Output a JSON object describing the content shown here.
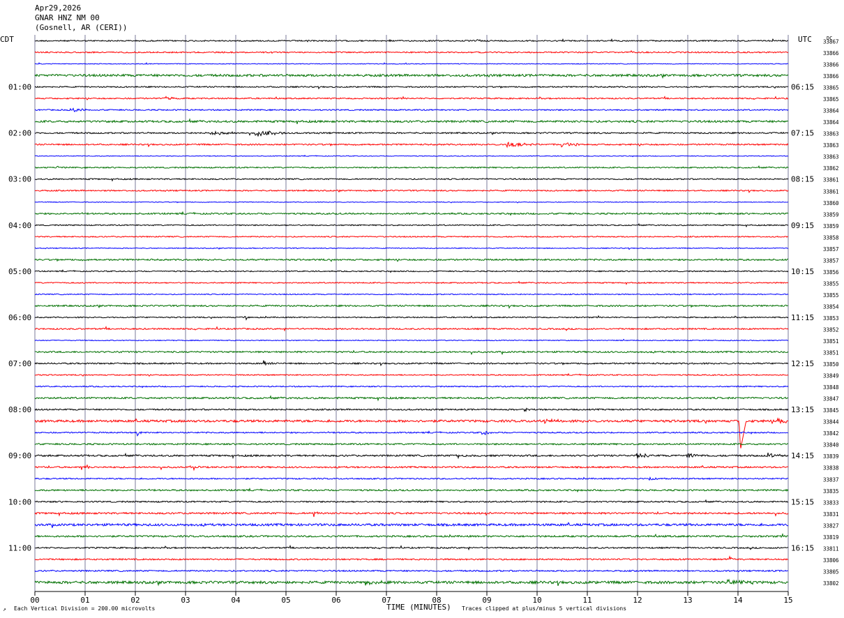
{
  "header": {
    "date": "Apr29,2026",
    "station": "GNAR HNZ NM 00",
    "location": "(Gosnell, AR (CERI))"
  },
  "labels": {
    "left_tz": "CDT",
    "right_tz": "UTC",
    "dc": "DC",
    "xlabel": "TIME (MINUTES)",
    "scale_note": "Each Vertical Division =  200.00 microvolts",
    "clip_note": "Traces clipped at plus/minus 5 vertical divisions"
  },
  "colors": {
    "cycle": [
      "#000000",
      "#ff0000",
      "#0000ff",
      "#007000"
    ],
    "grid_vertical": "#7a7a9a"
  },
  "chart_data": {
    "type": "line",
    "title": "",
    "xlabel": "TIME (MINUTES)",
    "ylabel": "",
    "xlim": [
      0,
      15
    ],
    "x_ticks": [
      "00",
      "01",
      "02",
      "03",
      "04",
      "05",
      "06",
      "07",
      "08",
      "09",
      "10",
      "11",
      "12",
      "13",
      "14",
      "15"
    ],
    "grid": true,
    "rows_count": 48,
    "left_hour_labels": [
      "01:00",
      "02:00",
      "03:00",
      "04:00",
      "05:00",
      "06:00",
      "07:00",
      "08:00",
      "09:00",
      "10:00",
      "11:00"
    ],
    "right_hour_labels": [
      "06:15",
      "07:15",
      "08:15",
      "09:15",
      "10:15",
      "11:15",
      "12:15",
      "13:15",
      "14:15",
      "15:15",
      "16:15"
    ],
    "dc_offsets": [
      33867,
      33866,
      33866,
      33866,
      33865,
      33865,
      33864,
      33864,
      33863,
      33863,
      33863,
      33862,
      33861,
      33861,
      33860,
      33859,
      33859,
      33858,
      33857,
      33857,
      33856,
      33855,
      33855,
      33854,
      33853,
      33852,
      33851,
      33851,
      33850,
      33849,
      33848,
      33847,
      33845,
      33844,
      33842,
      33840,
      33839,
      33838,
      33837,
      33835,
      33833,
      33831,
      33827,
      33819,
      33811,
      33806,
      33805,
      33802
    ],
    "noise": [
      0.9,
      0.9,
      0.5,
      1.6,
      0.9,
      0.9,
      0.9,
      1.4,
      1.0,
      1.0,
      0.5,
      0.9,
      0.9,
      0.9,
      0.5,
      1.1,
      0.8,
      0.8,
      0.6,
      1.1,
      0.8,
      0.8,
      0.7,
      1.1,
      0.8,
      1.0,
      0.6,
      1.1,
      1.0,
      0.8,
      0.8,
      1.2,
      1.0,
      1.6,
      0.9,
      1.1,
      1.2,
      1.1,
      0.9,
      1.1,
      1.0,
      1.2,
      1.6,
      1.2,
      1.0,
      1.0,
      1.0,
      1.8
    ],
    "events": [
      {
        "row": 0,
        "minute": 8.8,
        "amp": 3,
        "dur": 0.1
      },
      {
        "row": 5,
        "minute": 2.6,
        "amp": 3,
        "dur": 0.3
      },
      {
        "row": 6,
        "minute": 0.7,
        "amp": 3,
        "dur": 0.4
      },
      {
        "row": 8,
        "minute": 4.4,
        "amp": 6,
        "dur": 0.6
      },
      {
        "row": 8,
        "minute": 3.5,
        "amp": 3,
        "dur": 0.6
      },
      {
        "row": 9,
        "minute": 9.4,
        "amp": 4,
        "dur": 0.6
      },
      {
        "row": 9,
        "minute": 10.5,
        "amp": 4,
        "dur": 0.6
      },
      {
        "row": 11,
        "minute": 0.45,
        "amp": 4,
        "dur": 0.05
      },
      {
        "row": 24,
        "minute": 4.2,
        "amp": 4,
        "dur": 0.1
      },
      {
        "row": 28,
        "minute": 4.55,
        "amp": 5,
        "dur": 0.2
      },
      {
        "row": 32,
        "minute": 9.75,
        "amp": 3,
        "dur": 0.1
      },
      {
        "row": 33,
        "minute": 10.15,
        "amp": 4,
        "dur": 0.3
      },
      {
        "row": 33,
        "minute": 14.8,
        "amp": 5,
        "dur": 0.3
      },
      {
        "row": 34,
        "minute": 2.05,
        "amp": 6,
        "dur": 0.1
      },
      {
        "row": 34,
        "minute": 8.9,
        "amp": 5,
        "dur": 0.2
      },
      {
        "row": 36,
        "minute": 8.4,
        "amp": 3,
        "dur": 0.3
      },
      {
        "row": 36,
        "minute": 12.0,
        "amp": 4,
        "dur": 0.3
      },
      {
        "row": 36,
        "minute": 13.0,
        "amp": 4,
        "dur": 0.4
      },
      {
        "row": 36,
        "minute": 14.6,
        "amp": 4,
        "dur": 0.3
      },
      {
        "row": 37,
        "minute": 0.95,
        "amp": 6,
        "dur": 0.2
      },
      {
        "row": 37,
        "minute": 3.1,
        "amp": 6,
        "dur": 0.2
      },
      {
        "row": 38,
        "minute": 12.25,
        "amp": 3,
        "dur": 0.3
      },
      {
        "row": 41,
        "minute": 5.55,
        "amp": 5,
        "dur": 0.1
      },
      {
        "row": 41,
        "minute": 9.0,
        "amp": 4,
        "dur": 0.1
      },
      {
        "row": 45,
        "minute": 13.85,
        "amp": 6,
        "dur": 0.05
      },
      {
        "row": 47,
        "minute": 13.8,
        "amp": 4,
        "dur": 0.5
      },
      {
        "row": 47,
        "minute": 6.6,
        "amp": 3,
        "dur": 0.4
      }
    ],
    "clip_pulse": {
      "row": 33,
      "minute": 14.05,
      "depth": 41
    }
  }
}
